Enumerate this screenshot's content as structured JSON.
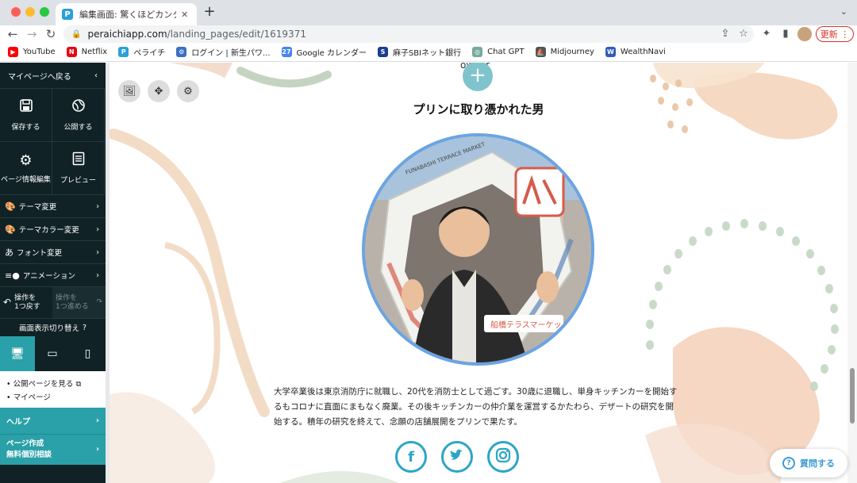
{
  "browser": {
    "tab_title": "編集画面: 驚くほどカンタン！無料",
    "tab_favicon": "P",
    "tab_close": "✕",
    "new_tab": "+",
    "url_host": "peraichiapp.com",
    "url_path": "/landing_pages/edit/1619371",
    "update_label": "更新 ⋮",
    "bookmarks": [
      {
        "label": "YouTube",
        "color": "#ff0000",
        "glyph": "▶"
      },
      {
        "label": "Netflix",
        "color": "#e50914",
        "glyph": "N"
      },
      {
        "label": "ペライチ",
        "color": "#2ba0d8",
        "glyph": "P"
      },
      {
        "label": "ログイン | 新生パワ...",
        "color": "#3a6fc4",
        "glyph": "⚙"
      },
      {
        "label": "Google カレンダー",
        "color": "#4285f4",
        "glyph": "27"
      },
      {
        "label": "麻子SBIネット銀行",
        "color": "#1a3d8f",
        "glyph": "S"
      },
      {
        "label": "Chat GPT",
        "color": "#74aa9c",
        "glyph": "◎"
      },
      {
        "label": "Midjourney",
        "color": "#555555",
        "glyph": "⛵"
      },
      {
        "label": "WealthNavi",
        "color": "#2f5db8",
        "glyph": "W"
      }
    ]
  },
  "sidebar": {
    "back_label": "マイページへ戻る",
    "save_label": "保存する",
    "publish_label": "公開する",
    "page_info_label": "ページ情報編集",
    "preview_label": "プレビュー",
    "theme_label": "テーマ変更",
    "theme_color_label": "テーマカラー変更",
    "font_label": "フォント変更",
    "animation_label": "アニメーション",
    "undo_label_1": "操作を",
    "undo_label_2": "1つ戻す",
    "redo_label_1": "操作を",
    "redo_label_2": "1つ進める",
    "display_switch_label": "画面表示切り替え",
    "view_public_label": "• 公開ページを見る",
    "mypage_label": "• マイページ",
    "help_label": "ヘルプ",
    "consult_label_1": "ページ作成",
    "consult_label_2": "無料個別相談"
  },
  "canvas": {
    "owner_tag": "owner",
    "heading": "プリンに取り憑かれた男",
    "bio": "大学卒業後は東京消防庁に就職し、20代を消防士として過ごす。30歳に退職し、単身キッチンカーを開始するもコロナに直面にまもなく廃業。その後キッチンカーの仲介業を運営するかたわら、デザートの研究を開始する。積年の研究を終えて、念願の店舗展開をプリンで果たす。",
    "photo_sign_text": "船橋テラスマーケット",
    "photo_banner_text": "FUNABASHI TERRACE MARKET",
    "question_label": "質問する"
  }
}
